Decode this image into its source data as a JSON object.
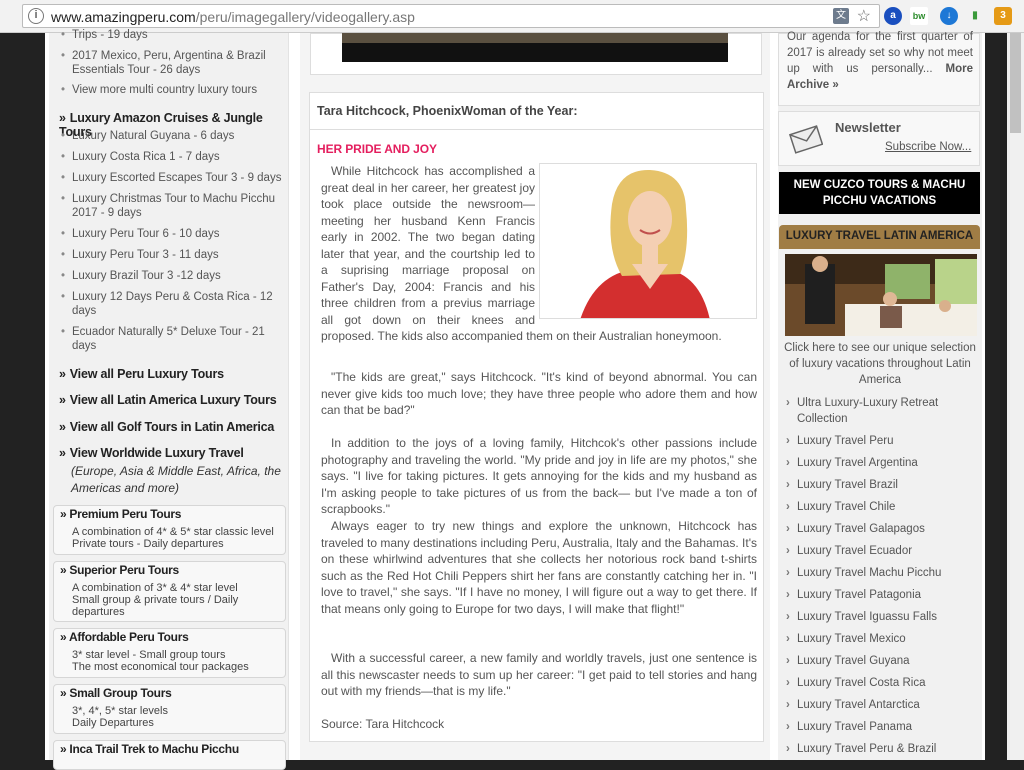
{
  "browser": {
    "url_host": "www.amazingperu.com",
    "url_path": "/peru/imagegallery/videogallery.asp"
  },
  "left": {
    "items_top": [
      "Trips - 19 days",
      "2017 Mexico, Peru, Argentina & Brazil Essentials Tour - 26 days",
      "View more multi country luxury tours"
    ],
    "amazon_heading": "Luxury Amazon Cruises & Jungle Tours",
    "amazon_items": [
      "Luxury Natural Guyana - 6 days",
      "Luxury Costa Rica 1 - 7 days",
      "Luxury Escorted Escapes Tour 3 - 9 days",
      "Luxury Christmas Tour to Machu Picchu 2017 - 9 days",
      "Luxury Peru Tour 6 - 10 days",
      "Luxury Peru Tour 3 - 11 days",
      "Luxury Brazil Tour 3 -12 days",
      "Luxury 12 Days Peru & Costa Rica - 12 days",
      "Ecuador Naturally 5* Deluxe Tour - 21 days"
    ],
    "view_links": [
      "View all Peru Luxury Tours",
      "View all Latin America Luxury Tours",
      "View all Golf Tours in Latin America",
      "View Worldwide Luxury Travel"
    ],
    "worldwide_sub": "(Europe, Asia & Middle East, Africa, the Americas and more)",
    "boxes": [
      {
        "title": "Premium Peru Tours",
        "lines": [
          "A combination of 4* & 5* star classic level",
          "Private tours - Daily departures"
        ]
      },
      {
        "title": "Superior Peru Tours",
        "lines": [
          "A combination of 3* & 4* star level",
          "Small group & private tours / Daily",
          "departures"
        ]
      },
      {
        "title": "Affordable Peru Tours",
        "lines": [
          "3* star level - Small group tours",
          "The most economical tour packages"
        ]
      },
      {
        "title": "Small Group Tours",
        "lines": [
          "3*, 4*, 5* star levels",
          "Daily Departures"
        ]
      },
      {
        "title": "Inca Trail Trek to Machu Picchu",
        "lines": []
      }
    ]
  },
  "article": {
    "title": "Tara Hitchcock, PhoenixWoman of the Year:",
    "subheading": "HER PRIDE AND JOY",
    "p1": "While Hitchcock has accomplished a great deal in her career, her greatest joy took place outside the newsroom—meeting her husband Kenn Francis early in 2002. The two began dating later that year, and the courtship led to a suprising marriage proposal on Father's Day, 2004: Francis and his three children from a previus marriage all got down on their knees and proposed. The kids also accompanied them on their Australian honeymoon.",
    "p2": "\"The kids are great,\" says Hitchcock. \"It's kind of beyond abnormal. You can never give kids too much love; they have three people who adore them and how can that be bad?\"",
    "p3": "In addition to the joys of a loving family, Hitchcok's other passions include photography and traveling the world. \"My pride and joy in life are my photos,\" she says. \"I live for taking pictures. It gets annoying for the kids and my husband as I'm asking people to take pictures of us from the back— but I've made a ton of scrapbooks.\"",
    "p4": "Always eager to try new things and explore the unknown, Hitchcock has traveled to many destinations including Peru, Australia, Italy and the Bahamas. It's on these whirlwind adventures that she collects her notorious rock band t-shirts such as the Red Hot Chili Peppers shirt her fans are constantly catching her in. \"I love to travel,\" she says. \"If I have no money, I will figure out a way to get there. If that means only going to Europe for two days, I will make that flight!\"",
    "p5": "With a successful career, a new family and worldly travels, just one sentence is all this newscaster needs to sum up her career: \"I get paid to tell stories and hang out with my friends—that is my life.\"",
    "source": "Source: Tara Hitchcock"
  },
  "right": {
    "agenda_text": "Our agenda for the first quarter of 2017 is already set so why not meet up with us personally...",
    "agenda_more": "More Archive »",
    "newsletter_title": "Newsletter",
    "newsletter_link": "Subscribe Now...",
    "cuzco_line1": "NEW CUZCO TOURS & MACHU",
    "cuzco_line2": "PICCHU VACATIONS",
    "ltla_title": "LUXURY TRAVEL LATIN AMERICA",
    "caption": "Click here to see our unique selection of luxury vacations throughout Latin America",
    "links": [
      "Ultra Luxury-Luxury Retreat Collection",
      "Luxury Travel Peru",
      "Luxury Travel Argentina",
      "Luxury Travel Brazil",
      "Luxury Travel Chile",
      "Luxury Travel Galapagos",
      "Luxury Travel Ecuador",
      "Luxury Travel Machu Picchu",
      "Luxury Travel Patagonia",
      "Luxury Travel Iguassu Falls",
      "Luxury Travel Mexico",
      "Luxury Travel Guyana",
      "Luxury Travel Costa Rica",
      "Luxury Travel Antarctica",
      "Luxury Travel Panama",
      "Luxury Travel Peru & Brazil"
    ]
  },
  "colors": {
    "accent_pink": "#e41e5e",
    "gold": "#a07d45"
  }
}
